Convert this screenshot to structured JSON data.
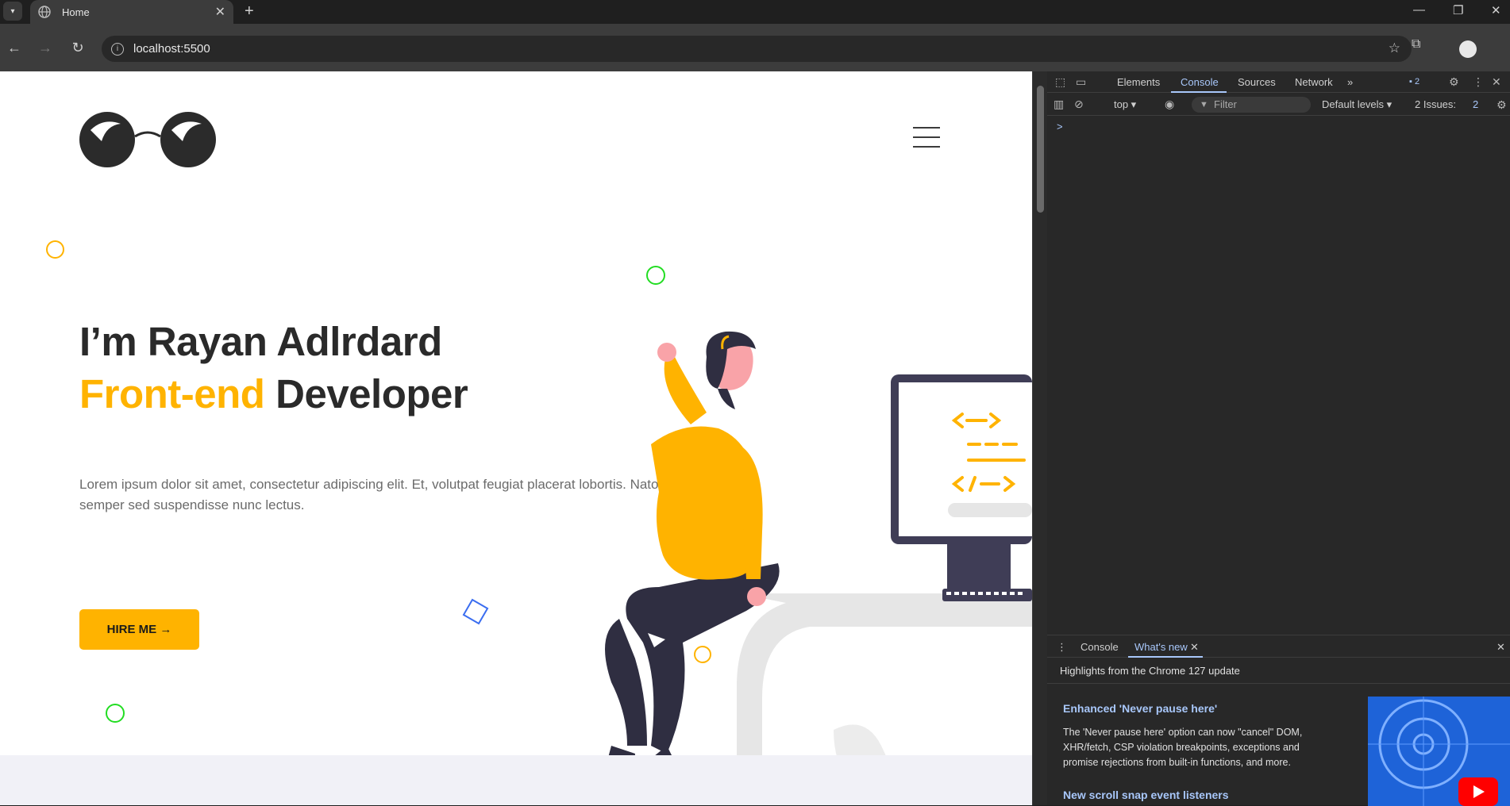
{
  "browser": {
    "tab_title": "Home",
    "new_tab_symbol": "+",
    "url": "localhost:5500"
  },
  "page": {
    "title_line1": "I’m Rayan Adlrdard",
    "title_accent": "Front-end",
    "title_rest": " Developer",
    "description": "Lorem ipsum dolor sit amet, consectetur adipiscing elit. Et, volutpat feugiat placerat lobortis. Natoque rutrum semper sed suspendisse nunc lectus.",
    "hire_button": "HIRE ME →",
    "colors": {
      "accent": "#ffb300",
      "text_dark": "#2a2a2a",
      "deco_green": "#22dd22",
      "deco_blue": "#3a6df0"
    }
  },
  "devtools": {
    "tabs": [
      "Elements",
      "Console",
      "Sources",
      "Network"
    ],
    "active_tab": "Console",
    "more_tabs": "»",
    "issues_badge": "2",
    "context": "top ▾",
    "filter_placeholder": "Filter",
    "levels": "Default levels ▾",
    "issues_label": "2 Issues:",
    "issues_count": "2",
    "prompt": ">",
    "drawer": {
      "tabs": [
        "Console",
        "What's new"
      ],
      "active_tab": "What's new",
      "highlights": "Highlights from the Chrome 127 update",
      "heading": "Enhanced 'Never pause here'",
      "body": "The 'Never pause here' option can now \"cancel\" DOM, XHR/fetch, CSP violation breakpoints, exceptions and promise rejections from built-in functions, and more.",
      "heading2": "New scroll snap event listeners"
    }
  }
}
